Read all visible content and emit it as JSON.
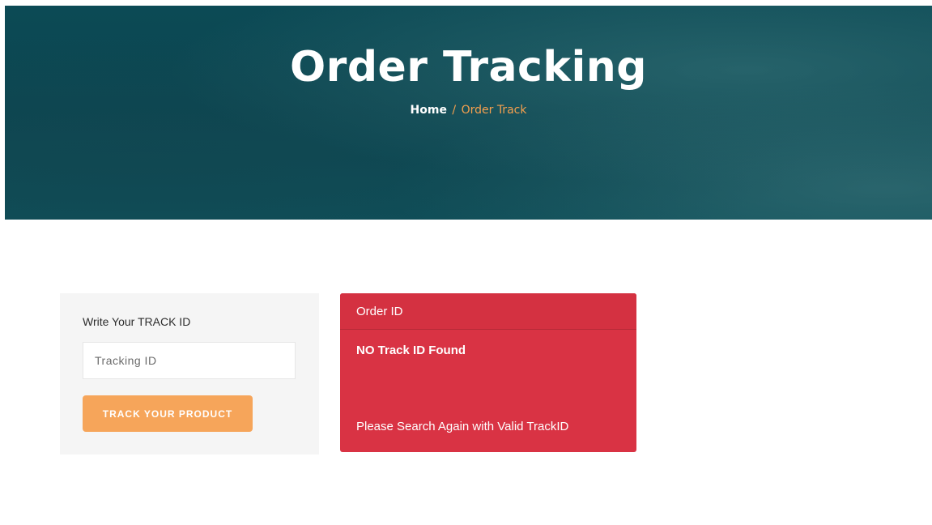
{
  "hero": {
    "title": "Order Tracking",
    "breadcrumb": {
      "home": "Home",
      "separator": "/",
      "current": "Order Track"
    }
  },
  "track_form": {
    "label": "Write Your TRACK ID",
    "input": {
      "placeholder": "Tracking ID",
      "value": ""
    },
    "button_label": "TRACK YOUR PRODUCT"
  },
  "result": {
    "header": "Order ID",
    "status": "NO Track ID Found",
    "message": "Please Search Again with Valid TrackID"
  },
  "colors": {
    "hero_bg": "#0c4a55",
    "accent_orange": "#f6a55a",
    "breadcrumb_active": "#f5a04e",
    "error_red": "#d93344",
    "form_bg": "#f5f5f5"
  }
}
